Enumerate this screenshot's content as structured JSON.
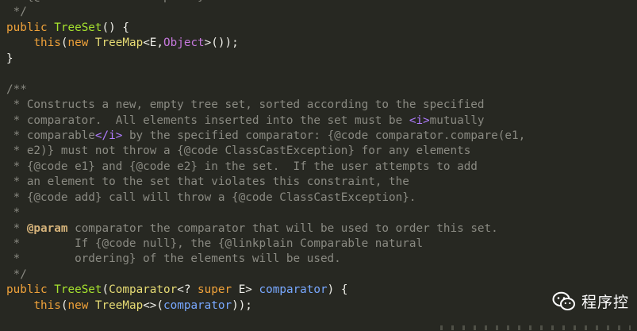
{
  "editor": {
    "lines": [
      [
        [
          "com",
          " * {@code ClassCastException}."
        ]
      ],
      [
        [
          "com",
          " */"
        ]
      ],
      [
        [
          "kw",
          "public "
        ],
        [
          "fn",
          "TreeSet"
        ],
        [
          "pun",
          "() {"
        ]
      ],
      [
        [
          "pun",
          "    "
        ],
        [
          "kw",
          "this"
        ],
        [
          "pun",
          "("
        ],
        [
          "kw",
          "new "
        ],
        [
          "typ",
          "TreeMap"
        ],
        [
          "pun",
          "<E,"
        ],
        [
          "pr",
          "Object"
        ],
        [
          "pun",
          ">());"
        ]
      ],
      [
        [
          "pun",
          "}"
        ]
      ],
      [
        [
          "pun",
          ""
        ]
      ],
      [
        [
          "com",
          "/**"
        ]
      ],
      [
        [
          "com",
          " * Constructs a new, empty tree set, sorted according to the specified"
        ]
      ],
      [
        [
          "com",
          " * comparator.  All elements inserted into the set must be "
        ],
        [
          "tag",
          "<i>"
        ],
        [
          "com",
          "mutually"
        ]
      ],
      [
        [
          "com",
          " * comparable"
        ],
        [
          "tag",
          "</i>"
        ],
        [
          "com",
          " by the specified comparator: {@code comparator.compare(e1,"
        ]
      ],
      [
        [
          "com",
          " * e2)} must not throw a {@code ClassCastException} for any elements"
        ]
      ],
      [
        [
          "com",
          " * {@code e1} and {@code e2} in the set.  If the user attempts to add"
        ]
      ],
      [
        [
          "com",
          " * an element to the set that violates this constraint, the"
        ]
      ],
      [
        [
          "com",
          " * {@code add} call will throw a {@code ClassCastException}."
        ]
      ],
      [
        [
          "com",
          " *"
        ]
      ],
      [
        [
          "com",
          " * "
        ],
        [
          "ann",
          "@param"
        ],
        [
          "com",
          " comparator the comparator that will be used to order this set."
        ]
      ],
      [
        [
          "com",
          " *        If {@code null}, the {@linkplain Comparable natural"
        ]
      ],
      [
        [
          "com",
          " *        ordering} of the elements will be used."
        ]
      ],
      [
        [
          "com",
          " */"
        ]
      ],
      [
        [
          "kw",
          "public "
        ],
        [
          "fn",
          "TreeSet"
        ],
        [
          "pun",
          "("
        ],
        [
          "typ",
          "Comparator"
        ],
        [
          "pun",
          "<? "
        ],
        [
          "kw",
          "super "
        ],
        [
          "pun",
          "E> "
        ],
        [
          "par",
          "comparator"
        ],
        [
          "pun",
          ") {"
        ]
      ],
      [
        [
          "pun",
          "    "
        ],
        [
          "kw",
          "this"
        ],
        [
          "pun",
          "("
        ],
        [
          "kw",
          "new "
        ],
        [
          "typ",
          "TreeMap"
        ],
        [
          "pun",
          "<>("
        ],
        [
          "par",
          "comparator"
        ],
        [
          "pun",
          "));"
        ]
      ]
    ]
  },
  "watermark": {
    "text": "程序控",
    "icon": "wechat-icon"
  }
}
